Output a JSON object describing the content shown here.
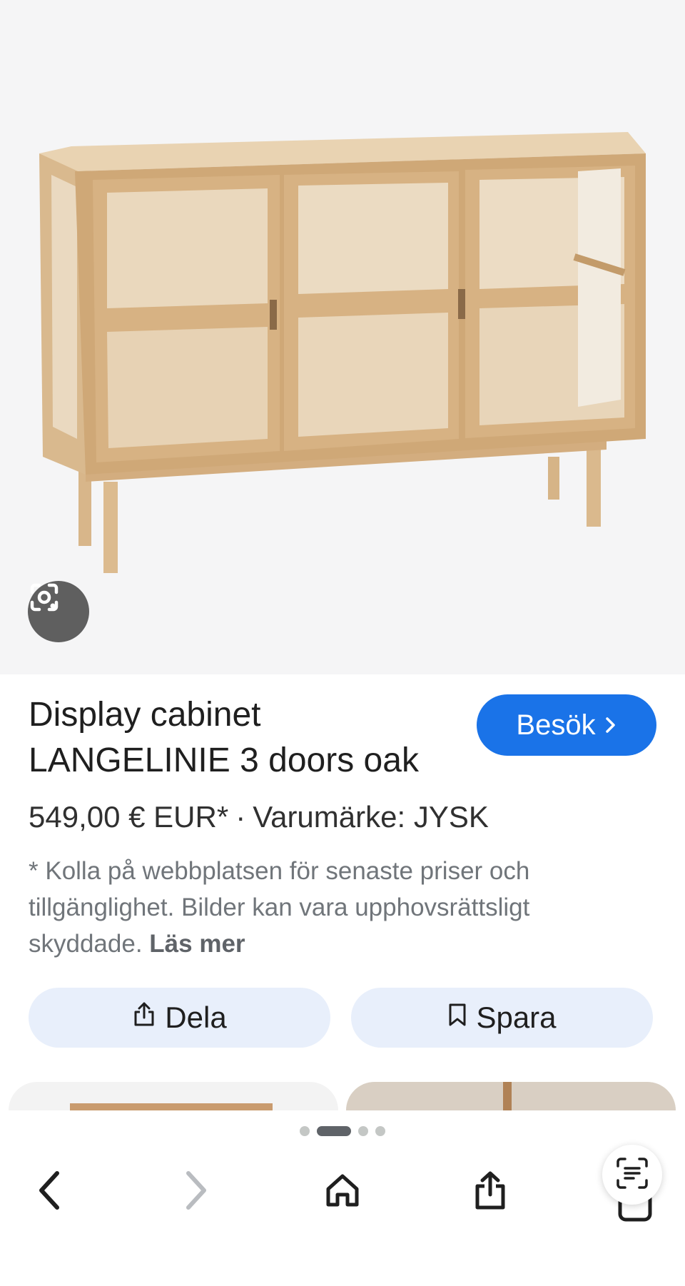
{
  "product": {
    "title": "Display cabinet LANGELINIE 3 doors oak",
    "visit_label": "Besök",
    "price": "549,00 € EUR*",
    "separator": "·",
    "brand": "Varumärke: JYSK",
    "disclaimer": "* Kolla på webbplatsen för senaste priser och tillgänglighet. Bilder kan vara upphovsrättsligt skyddade.",
    "read_more": "Läs mer"
  },
  "actions": {
    "share_label": "Dela",
    "save_label": "Spara"
  },
  "pager": {
    "count": 4,
    "active_index": 1
  },
  "nav": {
    "back_icon": "chevron-left-icon",
    "forward_icon": "chevron-right-icon",
    "home_icon": "home-icon",
    "share_icon": "share-icon",
    "tabs_icon": "tabs-icon"
  },
  "colors": {
    "accent": "#1a73e8",
    "action_bg": "#e8effb",
    "hero_bg": "#f5f5f6"
  }
}
